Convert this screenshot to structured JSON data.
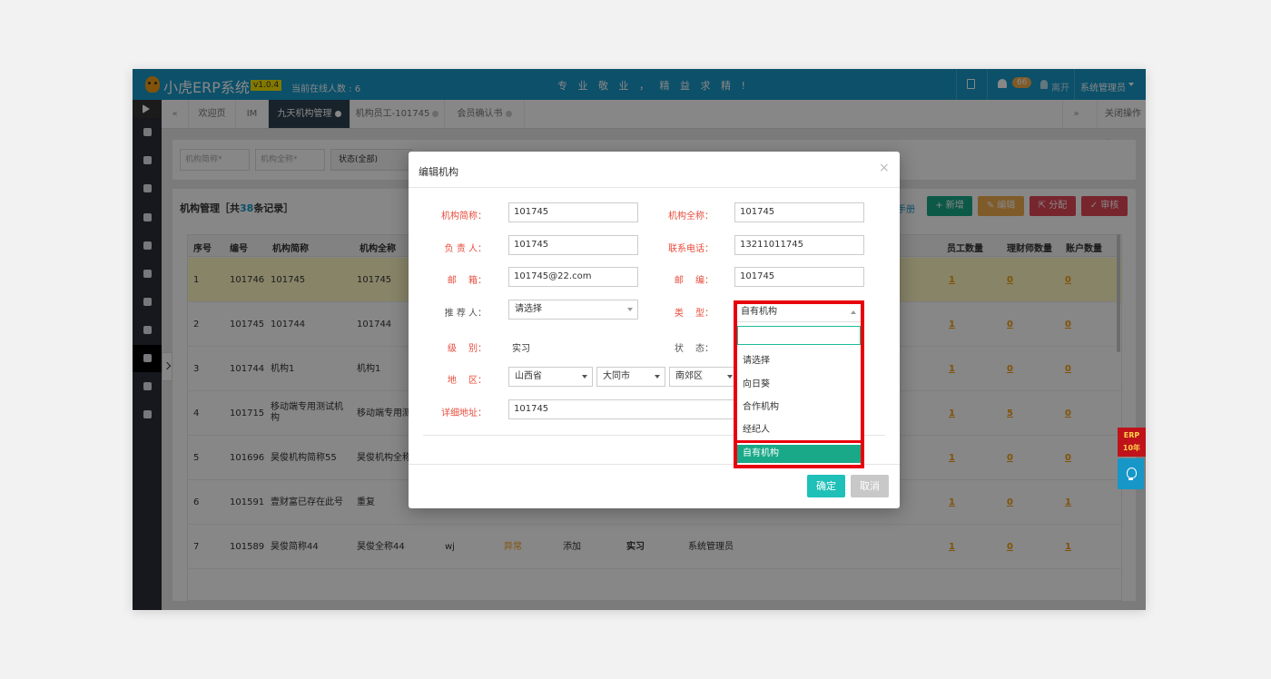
{
  "header": {
    "app_title": "小虎ERP系统",
    "version": "v1.0.4",
    "online_users": "当前在线人数 : 6",
    "slogan": "专 业 敬 业 ， 精 益 求 精 !",
    "notification_count": "66",
    "leave_label": "离开",
    "user_name": "系统管理员",
    "brand_color": "#1797c8"
  },
  "sidebar": {
    "icons": [
      "arrow-right-icon",
      "desktop-icon",
      "headphones-icon",
      "book-icon",
      "cloud-upload-icon",
      "filter-icon",
      "cloud-download-icon",
      "globe-icon",
      "thumbs-up-icon",
      "users-icon",
      "cart-icon",
      "gear-icon"
    ],
    "active_index": 9
  },
  "tabs": {
    "prev": "«",
    "next": "»",
    "items": [
      {
        "label": "欢迎页"
      },
      {
        "label": "IM"
      },
      {
        "label": "九天机构管理"
      },
      {
        "label": "机构员工-101745"
      },
      {
        "label": "会员确认书"
      }
    ],
    "active_index": 2,
    "close_ops": "关闭操作"
  },
  "filters": {
    "short_name_placeholder": "机构简称*",
    "full_name_placeholder": "机构全称*",
    "status_select": "状态(全部)"
  },
  "panel": {
    "title_prefix": "机构管理［共",
    "count": "38",
    "title_suffix": "条记录］",
    "manual": "手册",
    "buttons": {
      "add": "新增",
      "edit": "编辑",
      "assign": "分配",
      "review": "审核"
    },
    "columns": [
      "序号",
      "编号",
      "机构简称",
      "机构全称",
      "员工数量",
      "理财师数量",
      "账户数量"
    ],
    "rows": [
      {
        "idx": "1",
        "id": "101746",
        "short": "101745",
        "full": "101745",
        "emp": "1",
        "planner": "0",
        "acct": "0"
      },
      {
        "idx": "2",
        "id": "101745",
        "short": "101744",
        "full": "101744",
        "emp": "1",
        "planner": "0",
        "acct": "0"
      },
      {
        "idx": "3",
        "id": "101744",
        "short": "机构1",
        "full": "机构1",
        "emp": "1",
        "planner": "0",
        "acct": "0"
      },
      {
        "idx": "4",
        "id": "101715",
        "short": "移动端专用测试机构",
        "full": "移动端专用测",
        "emp": "1",
        "planner": "5",
        "acct": "0"
      },
      {
        "idx": "5",
        "id": "101696",
        "short": "昊俊机构简称55",
        "full": "昊俊机构全称",
        "emp": "1",
        "planner": "0",
        "acct": "0"
      },
      {
        "idx": "6",
        "id": "101591",
        "short": "壹财富已存在此号",
        "full": "重复",
        "emp": "1",
        "planner": "0",
        "acct": "1"
      },
      {
        "idx": "7",
        "id": "101589",
        "short": "昊俊简称44",
        "full": "昊俊全称44",
        "emp": "1",
        "planner": "0",
        "acct": "1",
        "extra": {
          "contact": "wj",
          "status": "异常",
          "action": "添加",
          "level": "实习",
          "creator": "系统管理员"
        }
      }
    ]
  },
  "modal": {
    "title": "编辑机构",
    "close": "×",
    "fields": {
      "short_name": {
        "label": "机构简称：",
        "value": "101745"
      },
      "full_name": {
        "label": "机构全称：",
        "value": "101745"
      },
      "leader": {
        "label": "负 责 人：",
        "value": "101745"
      },
      "phone": {
        "label": "联系电话：",
        "value": "13211011745"
      },
      "email": {
        "label": "邮　 箱：",
        "value": "101745@22.com"
      },
      "zip": {
        "label": "邮　 编：",
        "value": "101745"
      },
      "referrer": {
        "label": "推 荐 人：",
        "value": "请选择"
      },
      "type": {
        "label": "类　 型：",
        "value": "自有机构"
      },
      "level": {
        "label": "级　 别：",
        "value": "实习"
      },
      "status": {
        "label": "状　 态："
      },
      "region": {
        "label": "地　 区：",
        "province": "山西省",
        "city": "大同市",
        "district": "南郊区"
      },
      "address": {
        "label": "详细地址：",
        "value": "101745"
      }
    },
    "confirm": "确定",
    "cancel": "取消"
  },
  "type_dropdown": {
    "selected": "自有机构",
    "options": [
      "请选择",
      "向日葵",
      "合作机构",
      "经纪人",
      "自有机构"
    ],
    "highlight_color": "#e8000c"
  },
  "floating": {
    "ad_line1": "ERP",
    "ad_line2": "10年"
  }
}
